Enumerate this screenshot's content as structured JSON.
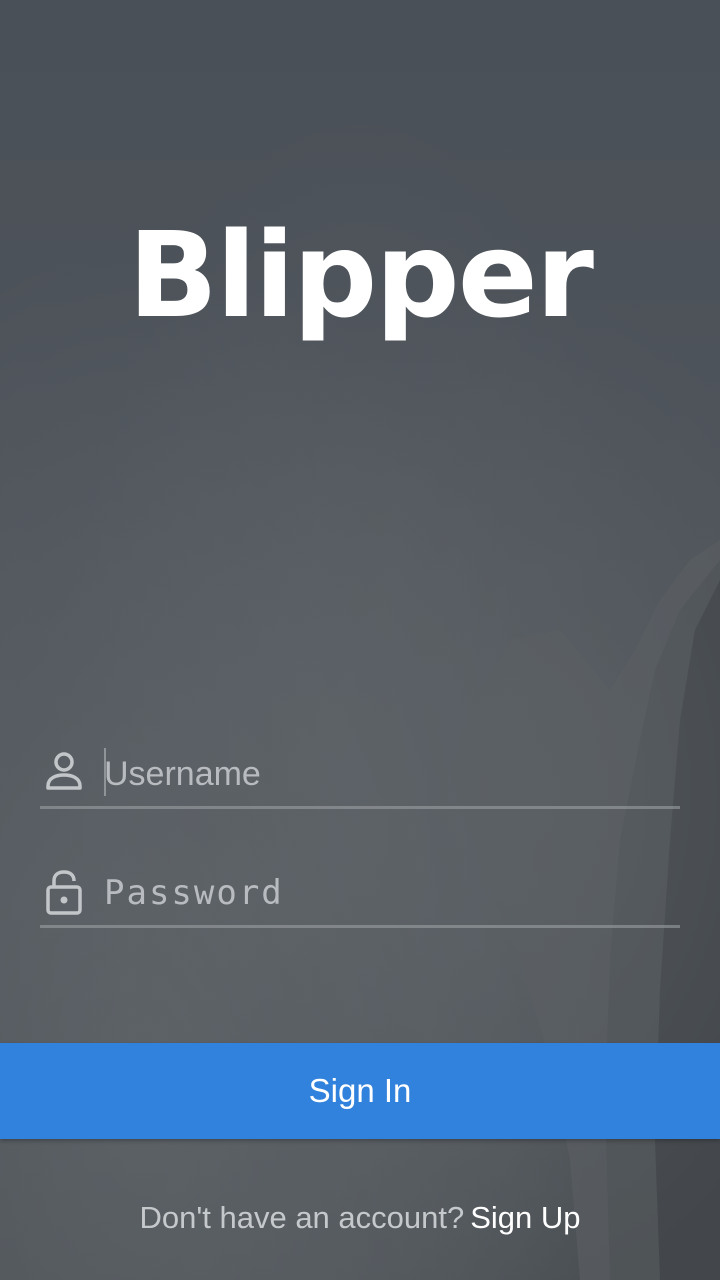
{
  "app": {
    "brand_name": "Blipper"
  },
  "login_form": {
    "username": {
      "placeholder": "Username",
      "value": "",
      "icon": "person-icon"
    },
    "password": {
      "placeholder": "Password",
      "value": "",
      "icon": "lock-icon"
    },
    "sign_in_label": "Sign In"
  },
  "footer": {
    "prompt": "Don't have an account?",
    "sign_up_label": "Sign Up"
  },
  "colors": {
    "primary_button": "#3182dc",
    "background": "#4d5359",
    "text_primary": "#ffffff",
    "text_muted": "#c6c9cc"
  }
}
